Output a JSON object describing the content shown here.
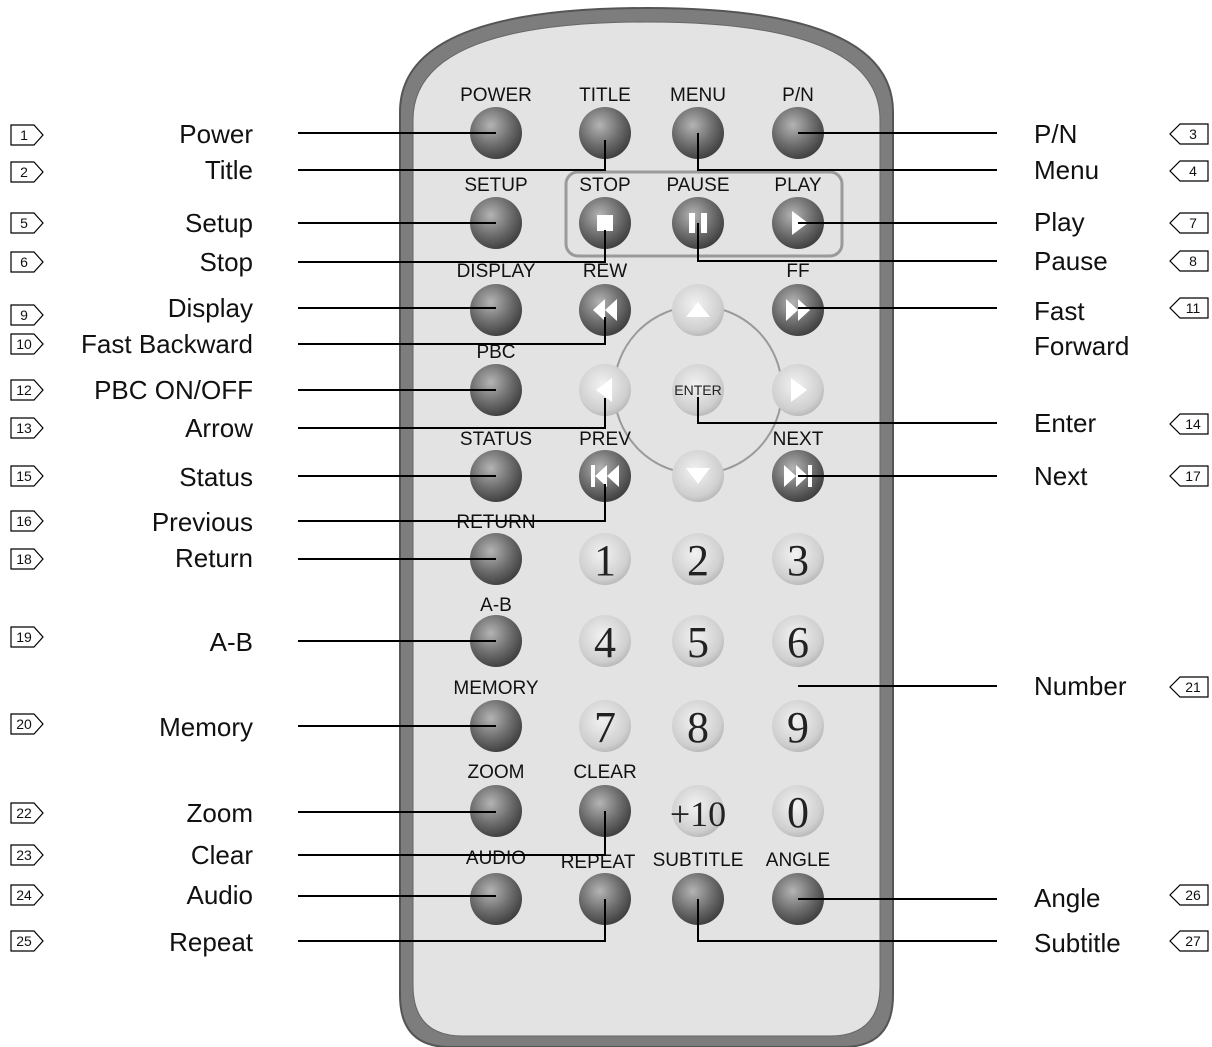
{
  "remote": {
    "buttons": [
      {
        "id": "power",
        "label": "POWER"
      },
      {
        "id": "title",
        "label": "TITLE"
      },
      {
        "id": "menu",
        "label": "MENU"
      },
      {
        "id": "pn",
        "label": "P/N"
      },
      {
        "id": "setup",
        "label": "SETUP"
      },
      {
        "id": "stop",
        "label": "STOP"
      },
      {
        "id": "pause",
        "label": "PAUSE"
      },
      {
        "id": "play",
        "label": "PLAY"
      },
      {
        "id": "display",
        "label": "DISPLAY"
      },
      {
        "id": "rew",
        "label": "REW"
      },
      {
        "id": "ff",
        "label": "FF"
      },
      {
        "id": "pbc",
        "label": "PBC"
      },
      {
        "id": "status",
        "label": "STATUS"
      },
      {
        "id": "prev",
        "label": "PREV"
      },
      {
        "id": "next",
        "label": "NEXT"
      },
      {
        "id": "return",
        "label": "RETURN"
      },
      {
        "id": "ab",
        "label": "A-B"
      },
      {
        "id": "memory",
        "label": "MEMORY"
      },
      {
        "id": "zoom",
        "label": "ZOOM"
      },
      {
        "id": "clear",
        "label": "CLEAR"
      },
      {
        "id": "audio",
        "label": "AUDIO"
      },
      {
        "id": "repeat",
        "label": "REPEAT"
      },
      {
        "id": "subtitle",
        "label": "SUBTITLE"
      },
      {
        "id": "angle",
        "label": "ANGLE"
      }
    ],
    "enter_label": "ENTER",
    "digits": [
      "1",
      "2",
      "3",
      "4",
      "5",
      "6",
      "7",
      "8",
      "9",
      "+10",
      "0"
    ]
  },
  "callouts_left": [
    {
      "num": "1",
      "label": "Power"
    },
    {
      "num": "2",
      "label": "Title"
    },
    {
      "num": "5",
      "label": "Setup"
    },
    {
      "num": "6",
      "label": "Stop"
    },
    {
      "num": "9",
      "label": "Display"
    },
    {
      "num": "10",
      "label": "Fast Backward"
    },
    {
      "num": "12",
      "label": "PBC ON/OFF"
    },
    {
      "num": "13",
      "label": "Arrow"
    },
    {
      "num": "15",
      "label": "Status"
    },
    {
      "num": "16",
      "label": "Previous"
    },
    {
      "num": "18",
      "label": "Return"
    },
    {
      "num": "19",
      "label": "A-B"
    },
    {
      "num": "20",
      "label": "Memory"
    },
    {
      "num": "22",
      "label": "Zoom"
    },
    {
      "num": "23",
      "label": "Clear"
    },
    {
      "num": "24",
      "label": "Audio"
    },
    {
      "num": "25",
      "label": "Repeat"
    }
  ],
  "callouts_right": [
    {
      "num": "3",
      "label": "P/N"
    },
    {
      "num": "4",
      "label": "Menu"
    },
    {
      "num": "7",
      "label": "Play"
    },
    {
      "num": "8",
      "label": "Pause"
    },
    {
      "num": "11",
      "label": "Fast",
      "label2": "Forward"
    },
    {
      "num": "14",
      "label": "Enter"
    },
    {
      "num": "17",
      "label": "Next"
    },
    {
      "num": "21",
      "label": "Number"
    },
    {
      "num": "26",
      "label": "Angle"
    },
    {
      "num": "27",
      "label": "Subtitle"
    }
  ],
  "colors": {
    "body_outer": "#7a7a7a",
    "body_inner": "#e2e2e2",
    "button_dark": "#6a6a6a",
    "button_light": "#c8c8c8",
    "line": "#000000"
  }
}
